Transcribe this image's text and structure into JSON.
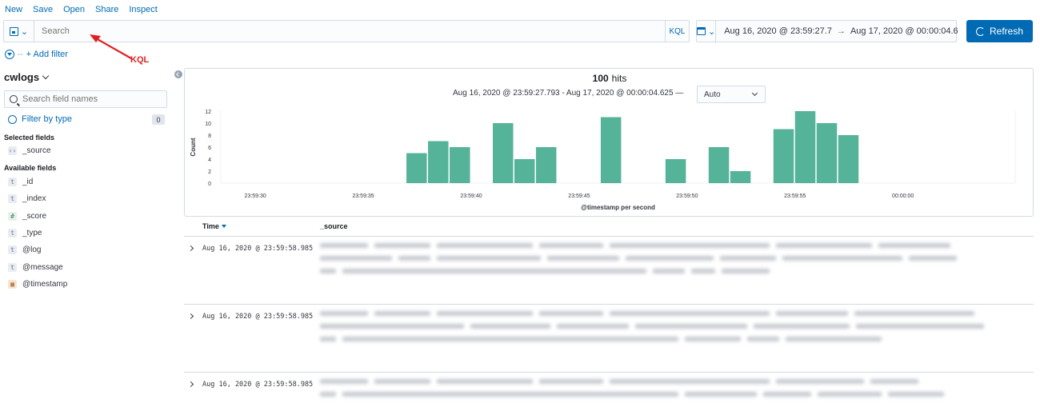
{
  "menu": {
    "new": "New",
    "save": "Save",
    "open": "Open",
    "share": "Share",
    "inspect": "Inspect"
  },
  "query": {
    "placeholder": "Search",
    "language": "KQL"
  },
  "time": {
    "start": "Aug 16, 2020 @ 23:59:27.7",
    "end": "Aug 17, 2020 @ 00:00:04.6",
    "arrow": "→"
  },
  "refresh_label": "Refresh",
  "filters": {
    "dashes": "--",
    "add_label": "+ Add filter"
  },
  "annotation": {
    "label": "KQL"
  },
  "sidebar": {
    "index_pattern": "cwlogs",
    "search_placeholder": "Search field names",
    "filter_by_type": "Filter by type",
    "filter_count": "0",
    "selected_heading": "Selected fields",
    "available_heading": "Available fields",
    "selected_fields": [
      {
        "name": "_source",
        "type": "</>"
      }
    ],
    "available_fields": [
      {
        "name": "_id",
        "type": "t"
      },
      {
        "name": "_index",
        "type": "t"
      },
      {
        "name": "_score",
        "type": "#"
      },
      {
        "name": "_type",
        "type": "t"
      },
      {
        "name": "@log",
        "type": "t"
      },
      {
        "name": "@message",
        "type": "t"
      },
      {
        "name": "@timestamp",
        "type": "date"
      }
    ]
  },
  "histogram": {
    "hits_count": "100",
    "hits_label": "hits",
    "range": "Aug 16, 2020 @ 23:59:27.793 - Aug 17, 2020 @ 00:00:04.625 —",
    "interval": "Auto"
  },
  "chart_data": {
    "type": "bar",
    "xlabel": "@timestamp per second",
    "ylabel": "Count",
    "ylim": [
      0,
      12
    ],
    "yticks": [
      0,
      2,
      4,
      6,
      8,
      10,
      12
    ],
    "x_tick_labels": [
      "23:59:30",
      "23:59:35",
      "23:59:40",
      "23:59:45",
      "23:59:50",
      "23:59:55",
      "00:00:00"
    ],
    "x_range_seconds": [
      -31.6,
      5.2
    ],
    "x_ticks_seconds": [
      -30,
      -25,
      -20,
      -15,
      -10,
      -5,
      0
    ],
    "bars": [
      {
        "t": -23,
        "value": 5
      },
      {
        "t": -22,
        "value": 7
      },
      {
        "t": -21,
        "value": 6
      },
      {
        "t": -19,
        "value": 10
      },
      {
        "t": -18,
        "value": 4
      },
      {
        "t": -17,
        "value": 6
      },
      {
        "t": -14,
        "value": 11
      },
      {
        "t": -11,
        "value": 4
      },
      {
        "t": -9,
        "value": 6
      },
      {
        "t": -8,
        "value": 2
      },
      {
        "t": -6,
        "value": 9
      },
      {
        "t": -5,
        "value": 12
      },
      {
        "t": -4,
        "value": 10
      },
      {
        "t": -3,
        "value": 8
      }
    ],
    "color": "#54b399"
  },
  "table": {
    "time_header": "Time",
    "source_header": "_source",
    "rows": [
      {
        "timestamp": "Aug 16, 2020 @ 23:59:58.985"
      },
      {
        "timestamp": "Aug 16, 2020 @ 23:59:58.985"
      },
      {
        "timestamp": "Aug 16, 2020 @ 23:59:58.985"
      }
    ]
  }
}
